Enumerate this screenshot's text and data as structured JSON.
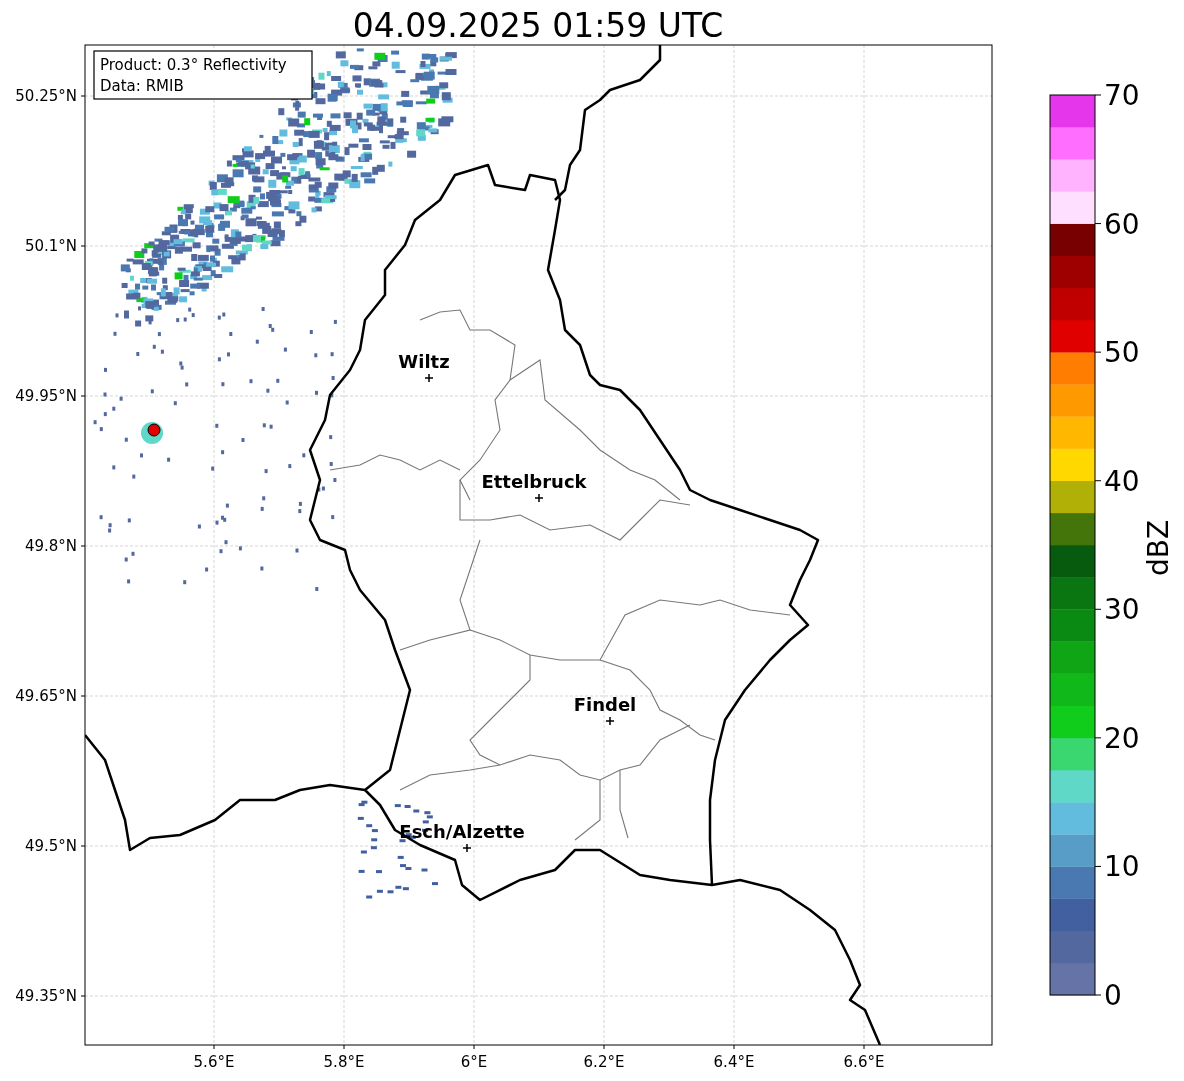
{
  "title": "04.09.2025 01:59 UTC",
  "info_box": [
    "Product: 0.3° Reflectivity",
    "Data: RMIB"
  ],
  "x_ticks": [
    "5.6°E",
    "5.8°E",
    "6°E",
    "6.2°E",
    "6.4°E",
    "6.6°E"
  ],
  "y_ticks": [
    "50.25°N",
    "50.1°N",
    "49.95°N",
    "49.8°N",
    "49.65°N",
    "49.5°N",
    "49.35°N"
  ],
  "cities": [
    {
      "name": "Wiltz"
    },
    {
      "name": "Ettelbruck"
    },
    {
      "name": "Findel"
    },
    {
      "name": "Esch/Alzette"
    }
  ],
  "colorbar": {
    "label": "dBZ",
    "ticks": [
      "70",
      "60",
      "50",
      "40",
      "30",
      "20",
      "10",
      "0"
    ],
    "bins": [
      {
        "color": "#6573a6"
      },
      {
        "color": "#52689f"
      },
      {
        "color": "#425fa0"
      },
      {
        "color": "#4a78b0"
      },
      {
        "color": "#589dc7"
      },
      {
        "color": "#62bcdd"
      },
      {
        "color": "#5fd8c7"
      },
      {
        "color": "#3ad670"
      },
      {
        "color": "#10cc1b"
      },
      {
        "color": "#11b81a"
      },
      {
        "color": "#10a515"
      },
      {
        "color": "#0b8a13"
      },
      {
        "color": "#0a7612"
      },
      {
        "color": "#065b0e"
      },
      {
        "color": "#43750b"
      },
      {
        "color": "#b0b006"
      },
      {
        "color": "#ffd800"
      },
      {
        "color": "#ffb700"
      },
      {
        "color": "#ff9900"
      },
      {
        "color": "#ff7d00"
      },
      {
        "color": "#e00000"
      },
      {
        "color": "#c00000"
      },
      {
        "color": "#9e0000"
      },
      {
        "color": "#780000"
      },
      {
        "color": "#ffdfff"
      },
      {
        "color": "#ffb3ff"
      },
      {
        "color": "#ff6eff"
      },
      {
        "color": "#e636ec"
      }
    ]
  }
}
